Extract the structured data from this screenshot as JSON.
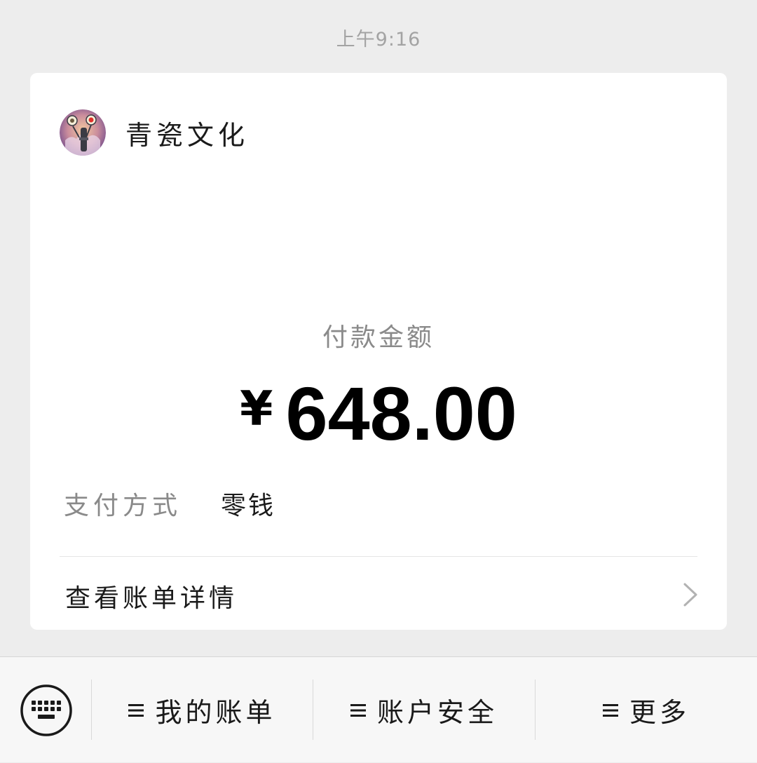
{
  "timestamp": "上午9:16",
  "merchant": {
    "name": "青瓷文化",
    "avatar_icon": "avatar-illustration"
  },
  "payment": {
    "amount_label": "付款金额",
    "currency_symbol": "¥",
    "amount": "648.00",
    "method_label": "支付方式",
    "method_value": "零钱"
  },
  "details": {
    "label": "查看账单详情",
    "icon": "chevron-right-icon"
  },
  "bottom_menu": {
    "keyboard_icon": "keyboard-icon",
    "items": [
      {
        "label": "我的账单",
        "icon": "menu-lines-icon"
      },
      {
        "label": "账户安全",
        "icon": "menu-lines-icon"
      },
      {
        "label": "更多",
        "icon": "menu-lines-icon"
      }
    ]
  },
  "colors": {
    "background": "#ededed",
    "card": "#ffffff",
    "muted_text": "#8a8a8a",
    "primary_text": "#1a1a1a"
  }
}
